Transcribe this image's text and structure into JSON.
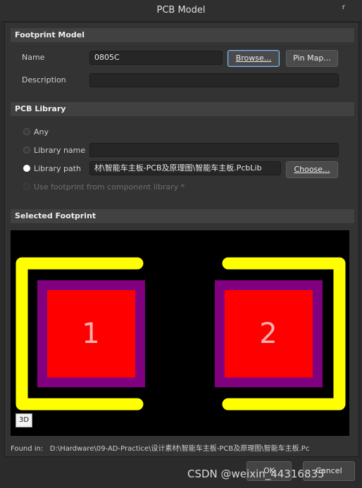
{
  "window": {
    "title": "PCB Model",
    "close_glyph": "r"
  },
  "footprint_model": {
    "header": "Footprint Model",
    "name_label": "Name",
    "name_value": "0805C",
    "browse_label": "Browse...",
    "pinmap_label": "Pin Map...",
    "description_label": "Description",
    "description_value": ""
  },
  "pcb_library": {
    "header": "PCB Library",
    "any_label": "Any",
    "library_name_label": "Library name",
    "library_name_value": "",
    "library_path_label": "Library path",
    "library_path_value": "材\\智能车主板-PCB及原理图\\智能车主板.PcbLib",
    "choose_label": "Choose...",
    "use_footprint_label": "Use footprint from component library *",
    "selected_option": "Library path"
  },
  "selected_footprint": {
    "header": "Selected Footprint",
    "pad1_label": "1",
    "pad2_label": "2",
    "btn_3d_label": "3D",
    "colors": {
      "background": "#000000",
      "silkscreen": "#ffff00",
      "pad_outline": "#800080",
      "pad_fill": "#ff0000",
      "pad_text": "#ffb0b0"
    }
  },
  "found_in": {
    "label": "Found in:",
    "value": "D:\\Hardware\\09-AD-Practice\\设计素材\\智能车主板-PCB及原理图\\智能车主板.Pc"
  },
  "footer": {
    "ok_label": "OK",
    "cancel_label": "Cancel"
  },
  "watermark": "CSDN @weixin_44316835"
}
